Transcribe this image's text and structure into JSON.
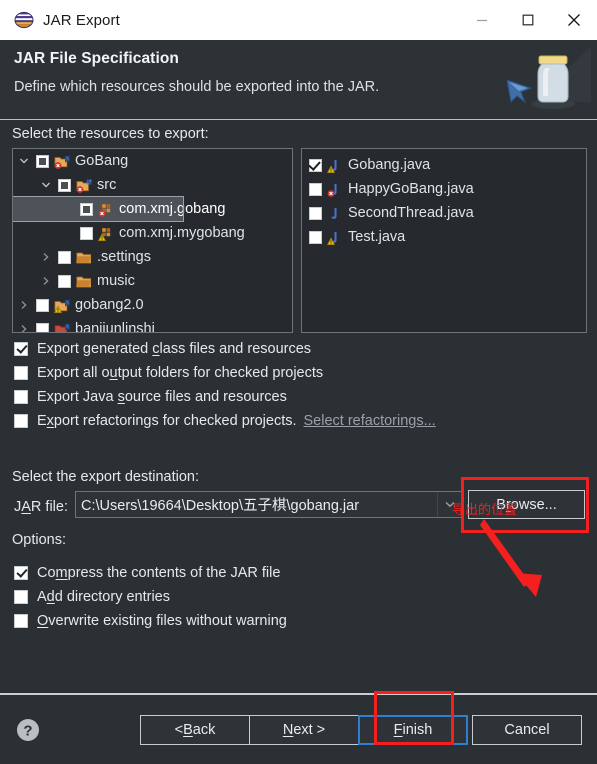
{
  "window": {
    "title": "JAR Export",
    "app_icon": "eclipse-icon",
    "controls": {
      "minimize": "minimize-icon",
      "maximize": "maximize-icon",
      "close": "close-icon"
    }
  },
  "header": {
    "title": "JAR File Specification",
    "subtitle": "Define which resources should be exported into the JAR.",
    "banner_icon": "jar-banner-icon"
  },
  "resources": {
    "label": "Select the resources to export:",
    "tree": [
      {
        "name": "GoBang",
        "indent": 0,
        "twisty": "expanded",
        "check": "gray",
        "icon": "project-error-icon"
      },
      {
        "name": "src",
        "indent": 1,
        "twisty": "expanded",
        "check": "gray",
        "icon": "source-folder-error-icon"
      },
      {
        "name": "com.xmj.gobang",
        "indent": 2,
        "twisty": "none",
        "check": "gray",
        "icon": "package-error-icon",
        "selected": true
      },
      {
        "name": "com.xmj.mygobang",
        "indent": 2,
        "twisty": "none",
        "check": "empty",
        "icon": "package-warning-icon"
      },
      {
        "name": ".settings",
        "indent": 1,
        "twisty": "collapsed",
        "check": "empty",
        "icon": "folder-icon"
      },
      {
        "name": "music",
        "indent": 1,
        "twisty": "collapsed",
        "check": "empty",
        "icon": "folder-icon"
      },
      {
        "name": "gobang2.0",
        "indent": 0,
        "twisty": "collapsed",
        "check": "empty",
        "icon": "project-warning-icon"
      },
      {
        "name": "banjiunlinshi",
        "indent": 0,
        "twisty": "collapsed",
        "check": "empty",
        "icon": "project-closed-icon"
      }
    ],
    "files": [
      {
        "name": "Gobang.java",
        "check": "checked",
        "icon": "java-file-warning-icon"
      },
      {
        "name": "HappyGoBang.java",
        "check": "empty",
        "icon": "java-file-error-icon"
      },
      {
        "name": "SecondThread.java",
        "check": "empty",
        "icon": "java-file-icon"
      },
      {
        "name": "Test.java",
        "check": "empty",
        "icon": "java-file-warning-icon"
      }
    ]
  },
  "export_options": [
    {
      "pre": "Export generated ",
      "mn": "c",
      "post": "lass files and resources",
      "checked": true
    },
    {
      "pre": "Export all o",
      "mn": "u",
      "post": "tput folders for checked projects",
      "checked": false
    },
    {
      "pre": "Export Java ",
      "mn": "s",
      "post": "ource files and resources",
      "checked": false
    },
    {
      "pre": "E",
      "mn": "x",
      "post": "port refactorings for checked projects.",
      "checked": false,
      "link": "Select refactorings..."
    }
  ],
  "destination": {
    "label": "Select the export destination:",
    "jar_label_pre": "J",
    "jar_label_mn": "A",
    "jar_label_post": "R file:",
    "jar_path": "C:\\Users\\19664\\Desktop\\五子棋\\gobang.jar",
    "dropdown_icon": "chevron-down-icon",
    "browse_pre": "B",
    "browse_mn": "r",
    "browse_post": "owse..."
  },
  "options": {
    "label": "Options:",
    "items": [
      {
        "pre": "Co",
        "mn": "m",
        "post": "press the contents of the JAR file",
        "checked": true
      },
      {
        "pre": "A",
        "mn": "d",
        "post": "d directory entries",
        "checked": false
      },
      {
        "pre": "",
        "mn": "O",
        "post": "verwrite existing files without warning",
        "checked": false
      }
    ]
  },
  "footer": {
    "help_icon": "help-icon",
    "buttons": [
      {
        "pre": "< ",
        "mn": "B",
        "post": "ack",
        "name": "back-button",
        "focused": false
      },
      {
        "pre": "",
        "mn": "N",
        "post": "ext >",
        "name": "next-button",
        "focused": false
      },
      {
        "pre": "",
        "mn": "F",
        "post": "inish",
        "name": "finish-button",
        "focused": true
      },
      {
        "pre": "",
        "mn": "",
        "post": "Cancel",
        "name": "cancel-button",
        "focused": false
      }
    ]
  },
  "annotations": {
    "text": "导出的位置",
    "color": "#f42020",
    "arrow_icon": "red-arrow-icon",
    "rect_browse": "highlight-browse",
    "rect_finish": "highlight-finish"
  }
}
